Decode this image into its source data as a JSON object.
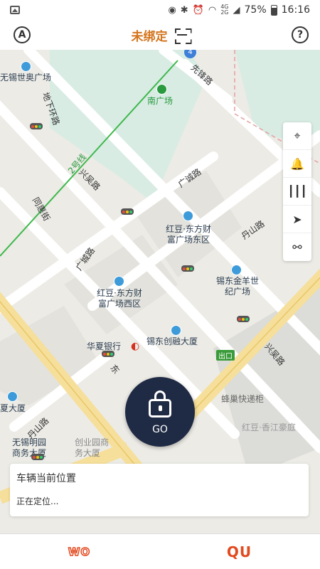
{
  "status_bar": {
    "battery": "75%",
    "time": "16:16",
    "net_top": "4G",
    "net_bottom": "2G"
  },
  "header": {
    "left_icon": "A",
    "title": "未绑定",
    "right_icon": "?"
  },
  "map": {
    "roads": [
      "先锋路",
      "地下环路",
      "兴吴路",
      "广诚路",
      "同惠街",
      "广城路",
      "丹山路",
      "东",
      "丹山路",
      "兴吴路"
    ],
    "metro_line": "2号线",
    "pois": [
      "无锡世奥广场",
      "南广场",
      "红豆·东方财富广场东区",
      "锡东金羊世纪广场",
      "红豆·东方财富广场西区",
      "锡东创融大厦",
      "华夏银行",
      "出口",
      "蜂巢快递柜",
      "红豆·香江豪庭",
      "夏大厦",
      "无锡明园商务大厦",
      "创业园商务大厦"
    ],
    "route_badge": "4"
  },
  "tools": [
    "locate-icon",
    "bell-icon",
    "chart-icon",
    "navigate-icon",
    "motorbike-icon"
  ],
  "go_button": {
    "label": "GO"
  },
  "location_card": {
    "title": "车辆当前位置",
    "status": "正在定位..."
  },
  "bottom_tabs": {
    "left": "WO",
    "right": "QU"
  },
  "colors": {
    "accent": "#d4741c",
    "go_bg": "#1f2a44",
    "brand": "#e24a1f",
    "metro": "#2a9a3f"
  }
}
